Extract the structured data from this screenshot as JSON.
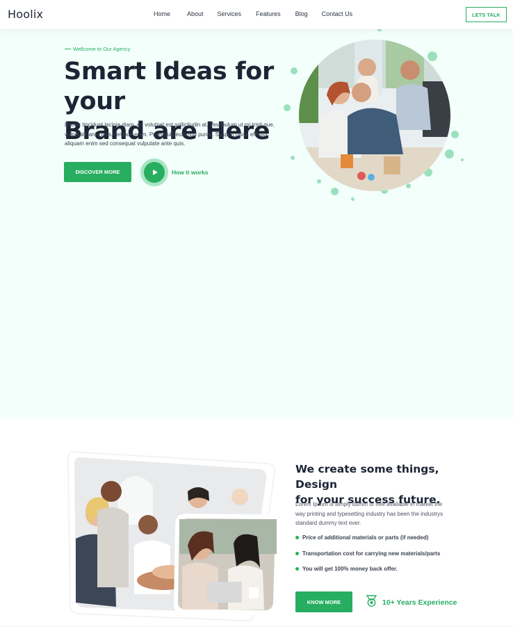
{
  "header": {
    "logo": "Hoolix",
    "nav": [
      "Home",
      "About",
      "Services",
      "Features",
      "Blog",
      "Contact Us"
    ],
    "cta_label": "LETS TALK"
  },
  "hero": {
    "tagline": "Wellcome to Our Agency",
    "title_line1": "Smart Ideas for your",
    "title_line2": "Brand are Here",
    "text": "Donec tincidunt lacinia diam, eu volutpat est sollicitudin at. Vestibulum ut mi tristi que, vulputate ante quis, tempus enim. Proin quis euismod purus. Suspen disse efficitur aliquam enim sed consequat vulputate ante quis.",
    "discover_label": "DISCOVER MORE",
    "how_label": "How it works"
  },
  "about": {
    "title_line1": "We create some things, Design",
    "title_line2": "for your success future.",
    "text": "Lorem Ipsum is simply dumm of free available in market the way printing and typesetting industry has been the industrys standard dummy text ever.",
    "bullets": [
      "Price of additional materials or parts (if needed)",
      "Transportation cost for carrying new materials/parts",
      "You will get 100% money back offer."
    ],
    "know_label": "KNOW MORE",
    "experience": "10+ Years Experience"
  },
  "colors": {
    "accent": "#27ae60",
    "hero_bg": "#f3fffa",
    "dot": "#9be0bd",
    "text_dark": "#1c2535"
  },
  "icons": {
    "play": "play-icon",
    "medal": "medal-icon"
  }
}
